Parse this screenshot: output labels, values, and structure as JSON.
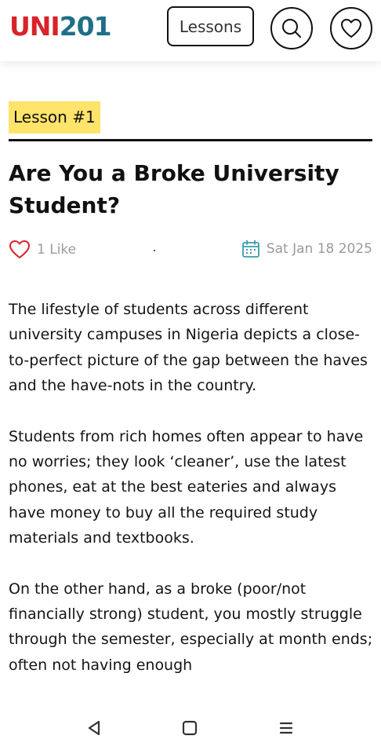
{
  "header": {
    "logo_part1": "UNI",
    "logo_part2": "201",
    "lessons_label": "Lessons",
    "search_icon": "search-icon",
    "favorite_icon": "heart-icon"
  },
  "article": {
    "tag": "Lesson #1",
    "title": "Are You a Broke University Student?",
    "likes": "1 Like",
    "date": "Sat Jan 18 2025",
    "paragraphs": [
      "The lifestyle of students across different university campuses in Nigeria depicts a close-to-perfect picture of the gap between the haves and the have-nots in the country.",
      "Students from rich homes often appear to have no worries; they look ‘cleaner’, use the latest phones, eat at the best eateries and always have money to buy all the required study materials and textbooks.",
      "On the other hand, as a broke (poor/not financially strong) student, you mostly struggle through the semester, especially at month ends; often not having enough"
    ]
  },
  "colors": {
    "logo_red": "#d8232a",
    "logo_teal": "#1f6f86",
    "tag_bg": "#ffe36b",
    "heart_red": "#d8232a",
    "calendar_teal": "#3a9bb0",
    "meta_gray": "#9a9a9a"
  },
  "navbar": {
    "back_icon": "back-triangle-icon",
    "home_icon": "home-square-icon",
    "menu_icon": "menu-lines-icon"
  }
}
